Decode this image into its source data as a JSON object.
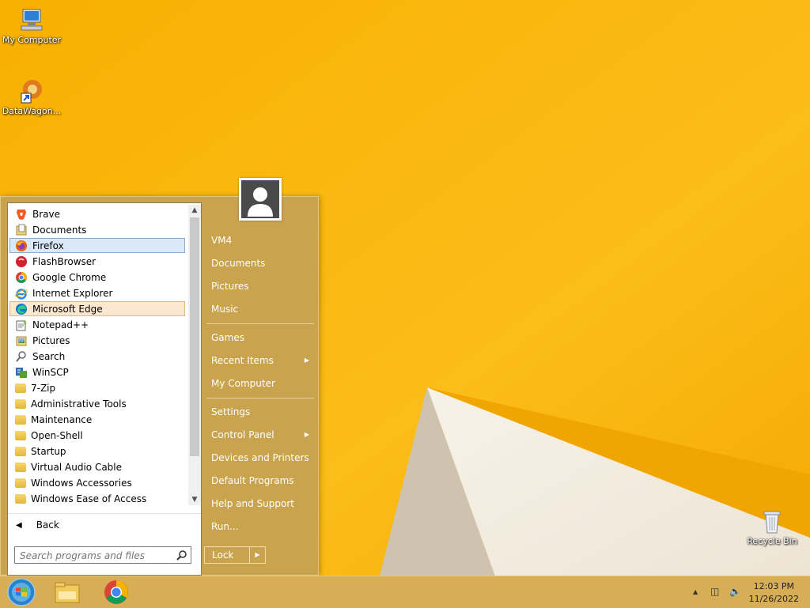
{
  "desktop": {
    "icons": [
      {
        "label": "My Computer"
      },
      {
        "label": "DataWagon..."
      },
      {
        "label": "Recycle Bin"
      }
    ]
  },
  "start_menu": {
    "programs": [
      {
        "label": "Brave",
        "icon": "brave-icon"
      },
      {
        "label": "Documents",
        "icon": "documents-icon"
      },
      {
        "label": "Firefox",
        "icon": "firefox-icon",
        "selected": "blue"
      },
      {
        "label": "FlashBrowser",
        "icon": "flashbrowser-icon"
      },
      {
        "label": "Google Chrome",
        "icon": "chrome-icon"
      },
      {
        "label": "Internet Explorer",
        "icon": "internet-explorer-icon"
      },
      {
        "label": "Microsoft Edge",
        "icon": "edge-icon",
        "selected": "orange"
      },
      {
        "label": "Notepad++",
        "icon": "notepad-plus-plus-icon"
      },
      {
        "label": "Pictures",
        "icon": "pictures-icon"
      },
      {
        "label": "Search",
        "icon": "search-icon"
      },
      {
        "label": "WinSCP",
        "icon": "winscp-icon"
      },
      {
        "label": "7-Zip",
        "icon": "folder-icon"
      },
      {
        "label": "Administrative Tools",
        "icon": "folder-icon"
      },
      {
        "label": "Maintenance",
        "icon": "folder-icon"
      },
      {
        "label": "Open-Shell",
        "icon": "folder-icon"
      },
      {
        "label": "Startup",
        "icon": "folder-icon"
      },
      {
        "label": "Virtual Audio Cable",
        "icon": "folder-icon"
      },
      {
        "label": "Windows Accessories",
        "icon": "folder-icon"
      },
      {
        "label": "Windows Ease of Access",
        "icon": "folder-icon"
      }
    ],
    "back_label": "Back",
    "search_placeholder": "Search programs and files",
    "right_items": [
      {
        "label": "VM4"
      },
      {
        "label": "Documents"
      },
      {
        "label": "Pictures"
      },
      {
        "label": "Music"
      },
      {
        "label": "Games"
      },
      {
        "label": "Recent Items",
        "submenu": true
      },
      {
        "label": "My Computer"
      },
      {
        "label": "Settings"
      },
      {
        "label": "Control Panel",
        "submenu": true
      },
      {
        "label": "Devices and Printers"
      },
      {
        "label": "Default Programs"
      },
      {
        "label": "Help and Support"
      },
      {
        "label": "Run..."
      }
    ],
    "lock_label": "Lock"
  },
  "taskbar": {
    "pinned": [
      "start-orb-icon",
      "file-explorer-icon",
      "chrome-icon"
    ],
    "clock_time": "12:03 PM",
    "clock_date": "11/26/2022"
  },
  "colors": {
    "wallpaper": "#f8b40e",
    "menu_bg": "#c9a34e",
    "selection_blue": "#dbe8f7",
    "selection_orange": "#fde7cf"
  }
}
